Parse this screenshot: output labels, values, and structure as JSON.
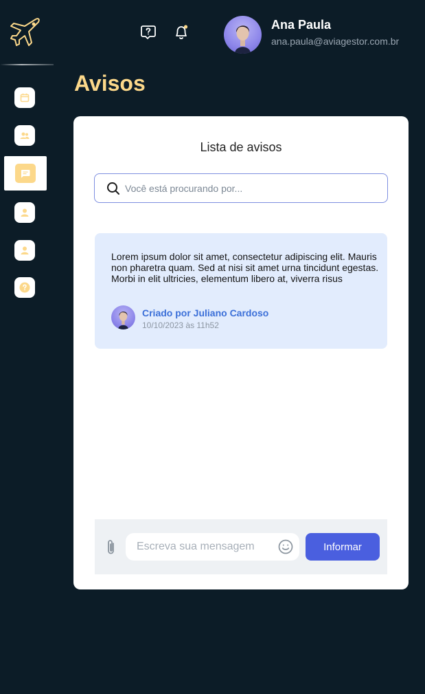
{
  "app": {
    "brand_icon": "airplane-icon"
  },
  "sidebar": {
    "items": [
      {
        "icon": "calendar-icon",
        "active": false
      },
      {
        "icon": "users-icon",
        "active": false
      },
      {
        "icon": "message-icon",
        "active": true
      },
      {
        "icon": "user-icon",
        "active": false
      },
      {
        "icon": "user-icon",
        "active": false
      },
      {
        "icon": "help-icon",
        "active": false
      }
    ]
  },
  "header": {
    "help_icon": "help-bubble-icon",
    "notification_icon": "bell-icon",
    "user": {
      "name": "Ana Paula",
      "email": "ana.paula@aviagestor.com.br"
    }
  },
  "page": {
    "title": "Avisos"
  },
  "card": {
    "title": "Lista de avisos",
    "search_placeholder": "Você está procurando por...",
    "notices": [
      {
        "text": "Lorem ipsum dolor sit amet, consectetur adipiscing elit. Mauris non pharetra quam. Sed at nisi sit amet urna tincidunt egestas. Morbi in elit ultricies, elementum libero at, viverra risus",
        "author": "Criado por Juliano Cardoso",
        "date": "10/10/2023 às 11h52"
      }
    ],
    "composer": {
      "placeholder": "Escreva sua mensagem",
      "send_label": "Informar"
    }
  },
  "colors": {
    "background": "#0c1c27",
    "accent": "#fcd88a",
    "primary": "#4a5fdf",
    "notice_bg": "#e2ecfd"
  }
}
